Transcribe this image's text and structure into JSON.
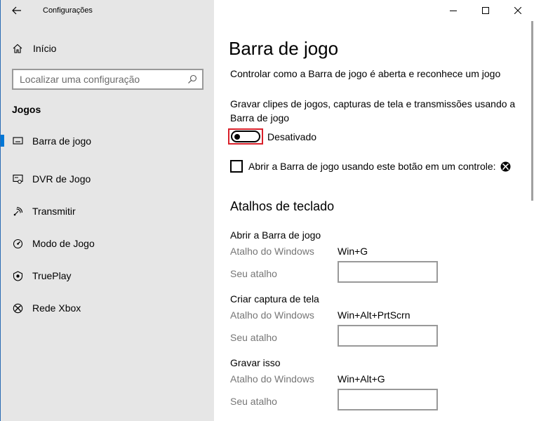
{
  "window": {
    "app_title": "Configurações",
    "controls": [
      "minimize",
      "maximize",
      "close"
    ]
  },
  "sidebar": {
    "home_label": "Início",
    "search_placeholder": "Localizar uma configuração",
    "section": "Jogos",
    "items": [
      {
        "label": "Barra de jogo",
        "icon": "game-bar-icon",
        "active": true
      },
      {
        "label": "DVR de Jogo",
        "icon": "game-dvr-icon",
        "active": false
      },
      {
        "label": "Transmitir",
        "icon": "broadcast-icon",
        "active": false
      },
      {
        "label": "Modo de Jogo",
        "icon": "game-mode-icon",
        "active": false
      },
      {
        "label": "TruePlay",
        "icon": "trueplay-icon",
        "active": false
      },
      {
        "label": "Rede Xbox",
        "icon": "xbox-icon",
        "active": false
      }
    ]
  },
  "main": {
    "title": "Barra de jogo",
    "description": "Controlar como a Barra de jogo é aberta e reconhece um jogo",
    "record_label": "Gravar clipes de jogos, capturas de tela e transmissões usando a Barra de jogo",
    "toggle": {
      "state": "off",
      "text": "Desativado"
    },
    "checkbox": {
      "checked": false,
      "label": "Abrir a Barra de jogo usando este botão em um controle:"
    },
    "shortcuts_heading": "Atalhos de teclado",
    "shortcuts": [
      {
        "title": "Abrir a Barra de jogo",
        "windows_label": "Atalho do Windows",
        "windows_value": "Win+G",
        "custom_label": "Seu atalho",
        "custom_value": ""
      },
      {
        "title": "Criar captura de tela",
        "windows_label": "Atalho do Windows",
        "windows_value": "Win+Alt+PrtScrn",
        "custom_label": "Seu atalho",
        "custom_value": ""
      },
      {
        "title": "Gravar isso",
        "windows_label": "Atalho do Windows",
        "windows_value": "Win+Alt+G",
        "custom_label": "Seu atalho",
        "custom_value": ""
      }
    ]
  },
  "colors": {
    "accent": "#0078d7",
    "sidebar_bg": "#e6e6e6",
    "highlight_border": "#d9202a",
    "secondary_text": "#767676"
  }
}
